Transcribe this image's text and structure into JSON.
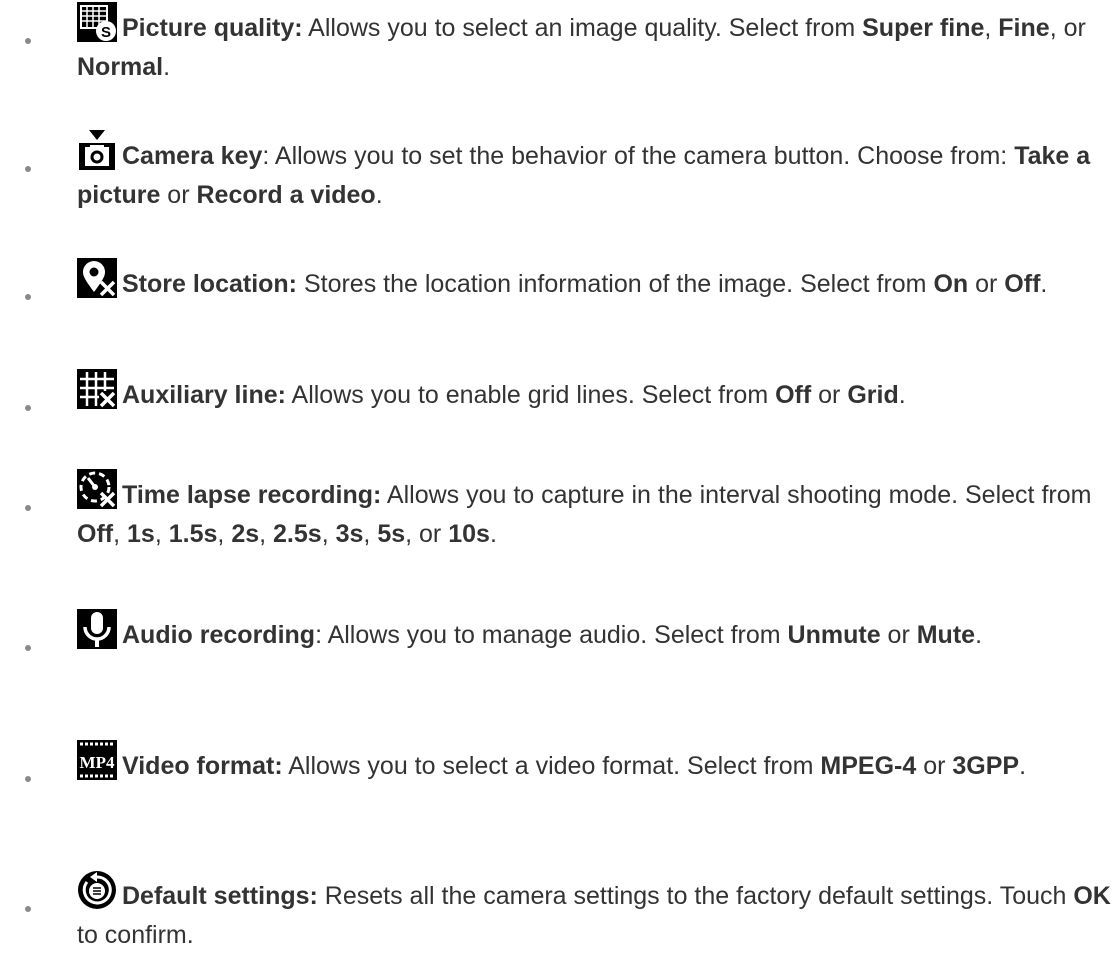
{
  "items": [
    {
      "icon": "picture-quality-icon",
      "parts": [
        {
          "b": true,
          "t": "Picture quality:"
        },
        {
          "b": false,
          "t": " Allows you to select an image quality. Select from "
        },
        {
          "b": true,
          "t": "Super fine"
        },
        {
          "b": false,
          "t": ", "
        },
        {
          "b": true,
          "t": "Fine"
        },
        {
          "b": false,
          "t": ", or "
        },
        {
          "b": true,
          "t": "Normal"
        },
        {
          "b": false,
          "t": "."
        }
      ]
    },
    {
      "icon": "camera-key-icon",
      "parts": [
        {
          "b": true,
          "t": "Camera key"
        },
        {
          "b": false,
          "t": ": Allows you to set the behavior of the camera button. Choose from: "
        },
        {
          "b": true,
          "t": "Take a picture"
        },
        {
          "b": false,
          "t": " or "
        },
        {
          "b": true,
          "t": "Record a video"
        },
        {
          "b": false,
          "t": "."
        }
      ]
    },
    {
      "icon": "store-location-icon",
      "parts": [
        {
          "b": true,
          "t": "Store location:"
        },
        {
          "b": false,
          "t": " Stores the location information of the image. Select from "
        },
        {
          "b": true,
          "t": "On"
        },
        {
          "b": false,
          "t": " or "
        },
        {
          "b": true,
          "t": "Off"
        },
        {
          "b": false,
          "t": "."
        }
      ]
    },
    {
      "icon": "auxiliary-line-icon",
      "parts": [
        {
          "b": true,
          "t": "Auxiliary line:"
        },
        {
          "b": false,
          "t": " Allows you to enable grid lines. Select from "
        },
        {
          "b": true,
          "t": "Off"
        },
        {
          "b": false,
          "t": " or "
        },
        {
          "b": true,
          "t": "Grid"
        },
        {
          "b": false,
          "t": "."
        }
      ]
    },
    {
      "icon": "time-lapse-icon",
      "parts": [
        {
          "b": true,
          "t": "Time lapse recording:"
        },
        {
          "b": false,
          "t": " Allows you to capture in the interval shooting mode. Select from "
        },
        {
          "b": true,
          "t": "Off"
        },
        {
          "b": false,
          "t": ", "
        },
        {
          "b": true,
          "t": "1s"
        },
        {
          "b": false,
          "t": ", "
        },
        {
          "b": true,
          "t": "1.5s"
        },
        {
          "b": false,
          "t": ", "
        },
        {
          "b": true,
          "t": "2s"
        },
        {
          "b": false,
          "t": ", "
        },
        {
          "b": true,
          "t": "2.5s"
        },
        {
          "b": false,
          "t": ", "
        },
        {
          "b": true,
          "t": "3s"
        },
        {
          "b": false,
          "t": ", "
        },
        {
          "b": true,
          "t": "5s"
        },
        {
          "b": false,
          "t": ", or "
        },
        {
          "b": true,
          "t": "10s"
        },
        {
          "b": false,
          "t": "."
        }
      ]
    },
    {
      "icon": "microphone-icon",
      "parts": [
        {
          "b": true,
          "t": "Audio recording"
        },
        {
          "b": false,
          "t": ": Allows you to manage audio. Select from "
        },
        {
          "b": true,
          "t": "Unmute"
        },
        {
          "b": false,
          "t": " or "
        },
        {
          "b": true,
          "t": "Mute"
        },
        {
          "b": false,
          "t": "."
        }
      ]
    },
    {
      "icon": "video-format-icon",
      "icon_text": "MP4",
      "parts": [
        {
          "b": true,
          "t": "Video format:"
        },
        {
          "b": false,
          "t": " Allows you to select a video format. Select from "
        },
        {
          "b": true,
          "t": "MPEG-4"
        },
        {
          "b": false,
          "t": " or "
        },
        {
          "b": true,
          "t": "3GPP"
        },
        {
          "b": false,
          "t": "."
        }
      ]
    },
    {
      "icon": "reset-settings-icon",
      "parts": [
        {
          "b": true,
          "t": "Default settings:"
        },
        {
          "b": false,
          "t": " Resets all the camera settings to the factory default settings. Touch "
        },
        {
          "b": true,
          "t": "OK"
        },
        {
          "b": false,
          "t": " to confirm."
        }
      ]
    }
  ]
}
